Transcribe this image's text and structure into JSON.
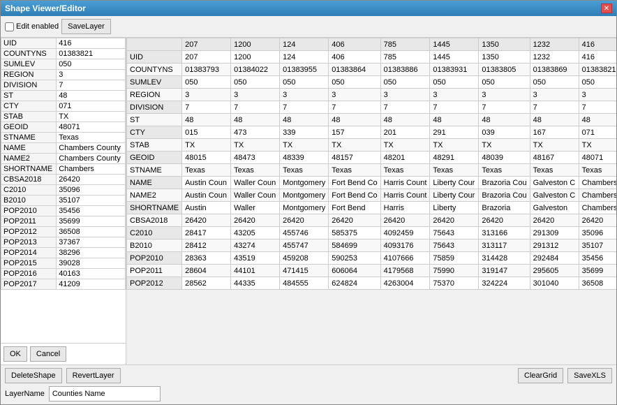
{
  "window": {
    "title": "Shape Viewer/Editor"
  },
  "toolbar": {
    "edit_enabled_label": "Edit enabled",
    "save_layer_label": "SaveLayer"
  },
  "left_grid": {
    "rows": [
      {
        "key": "UID",
        "value": "416"
      },
      {
        "key": "COUNTYNS",
        "value": "01383821"
      },
      {
        "key": "SUMLEV",
        "value": "050"
      },
      {
        "key": "REGION",
        "value": "3"
      },
      {
        "key": "DIVISION",
        "value": "7"
      },
      {
        "key": "ST",
        "value": "48"
      },
      {
        "key": "CTY",
        "value": "071"
      },
      {
        "key": "STAB",
        "value": "TX"
      },
      {
        "key": "GEOID",
        "value": "48071"
      },
      {
        "key": "STNAME",
        "value": "Texas"
      },
      {
        "key": "NAME",
        "value": "Chambers County"
      },
      {
        "key": "NAME2",
        "value": "Chambers County"
      },
      {
        "key": "SHORTNAME",
        "value": "Chambers"
      },
      {
        "key": "CBSA2018",
        "value": "26420"
      },
      {
        "key": "C2010",
        "value": "35096"
      },
      {
        "key": "B2010",
        "value": "35107"
      },
      {
        "key": "POP2010",
        "value": "35456"
      },
      {
        "key": "POP2011",
        "value": "35699"
      },
      {
        "key": "POP2012",
        "value": "36508"
      },
      {
        "key": "POP2013",
        "value": "37367"
      },
      {
        "key": "POP2014",
        "value": "38296"
      },
      {
        "key": "POP2015",
        "value": "39028"
      },
      {
        "key": "POP2016",
        "value": "40163"
      },
      {
        "key": "POP2017",
        "value": "41209"
      }
    ],
    "selected_index": -1
  },
  "left_actions": {
    "ok_label": "OK",
    "cancel_label": "Cancel"
  },
  "right_grid": {
    "columns": [
      "",
      "207",
      "1200",
      "124",
      "406",
      "785",
      "1445",
      "1350",
      "1232",
      "416"
    ],
    "rows": [
      {
        "key": "UID",
        "values": [
          "207",
          "1200",
          "124",
          "406",
          "785",
          "1445",
          "1350",
          "1232",
          "416"
        ]
      },
      {
        "key": "COUNTYNS",
        "values": [
          "01383793",
          "01384022",
          "01383955",
          "01383864",
          "01383886",
          "01383931",
          "01383805",
          "01383869",
          "01383821"
        ]
      },
      {
        "key": "SUMLEV",
        "values": [
          "050",
          "050",
          "050",
          "050",
          "050",
          "050",
          "050",
          "050",
          "050"
        ]
      },
      {
        "key": "REGION",
        "values": [
          "3",
          "3",
          "3",
          "3",
          "3",
          "3",
          "3",
          "3",
          "3"
        ]
      },
      {
        "key": "DIVISION",
        "values": [
          "7",
          "7",
          "7",
          "7",
          "7",
          "7",
          "7",
          "7",
          "7"
        ]
      },
      {
        "key": "ST",
        "values": [
          "48",
          "48",
          "48",
          "48",
          "48",
          "48",
          "48",
          "48",
          "48"
        ]
      },
      {
        "key": "CTY",
        "values": [
          "015",
          "473",
          "339",
          "157",
          "201",
          "291",
          "039",
          "167",
          "071"
        ]
      },
      {
        "key": "STAB",
        "values": [
          "TX",
          "TX",
          "TX",
          "TX",
          "TX",
          "TX",
          "TX",
          "TX",
          "TX"
        ]
      },
      {
        "key": "GEOID",
        "values": [
          "48015",
          "48473",
          "48339",
          "48157",
          "48201",
          "48291",
          "48039",
          "48167",
          "48071"
        ]
      },
      {
        "key": "STNAME",
        "values": [
          "Texas",
          "Texas",
          "Texas",
          "Texas",
          "Texas",
          "Texas",
          "Texas",
          "Texas",
          "Texas"
        ]
      },
      {
        "key": "NAME",
        "values": [
          "Austin Coun",
          "Waller Coun",
          "Montgomery",
          "Fort Bend Co",
          "Harris Count",
          "Liberty Cour",
          "Brazoria Cou",
          "Galveston C",
          "Chambers C"
        ]
      },
      {
        "key": "NAME2",
        "values": [
          "Austin Coun",
          "Waller Coun",
          "Montgomery",
          "Fort Bend Co",
          "Harris Count",
          "Liberty Cour",
          "Brazoria Cou",
          "Galveston C",
          "Chambers C"
        ],
        "highlight": [
          0,
          1
        ]
      },
      {
        "key": "SHORTNAME",
        "values": [
          "Austin",
          "Waller",
          "Montgomery",
          "Fort Bend",
          "Harris",
          "Liberty",
          "Brazoria",
          "Galveston",
          "Chambers"
        ]
      },
      {
        "key": "CBSA2018",
        "values": [
          "26420",
          "26420",
          "26420",
          "26420",
          "26420",
          "26420",
          "26420",
          "26420",
          "26420"
        ]
      },
      {
        "key": "C2010",
        "values": [
          "28417",
          "43205",
          "455746",
          "585375",
          "4092459",
          "75643",
          "313166",
          "291309",
          "35096"
        ]
      },
      {
        "key": "B2010",
        "values": [
          "28412",
          "43274",
          "455747",
          "584699",
          "4093176",
          "75643",
          "313117",
          "291312",
          "35107"
        ]
      },
      {
        "key": "POP2010",
        "values": [
          "28363",
          "43519",
          "459208",
          "590253",
          "4107666",
          "75859",
          "314428",
          "292484",
          "35456"
        ]
      },
      {
        "key": "POP2011",
        "values": [
          "28604",
          "44101",
          "471415",
          "606064",
          "4179568",
          "75990",
          "319147",
          "295605",
          "35699"
        ]
      },
      {
        "key": "POP2012",
        "values": [
          "28562",
          "44335",
          "484555",
          "624824",
          "4263004",
          "75370",
          "324224",
          "301040",
          "36508"
        ]
      }
    ]
  },
  "bottom_buttons": {
    "delete_shape_label": "DeleteShape",
    "revert_layer_label": "RevertLayer",
    "clear_grid_label": "ClearGrid",
    "save_xls_label": "SaveXLS"
  },
  "layer_name": {
    "label": "LayerName",
    "value": "Counties Name",
    "placeholder": ""
  }
}
